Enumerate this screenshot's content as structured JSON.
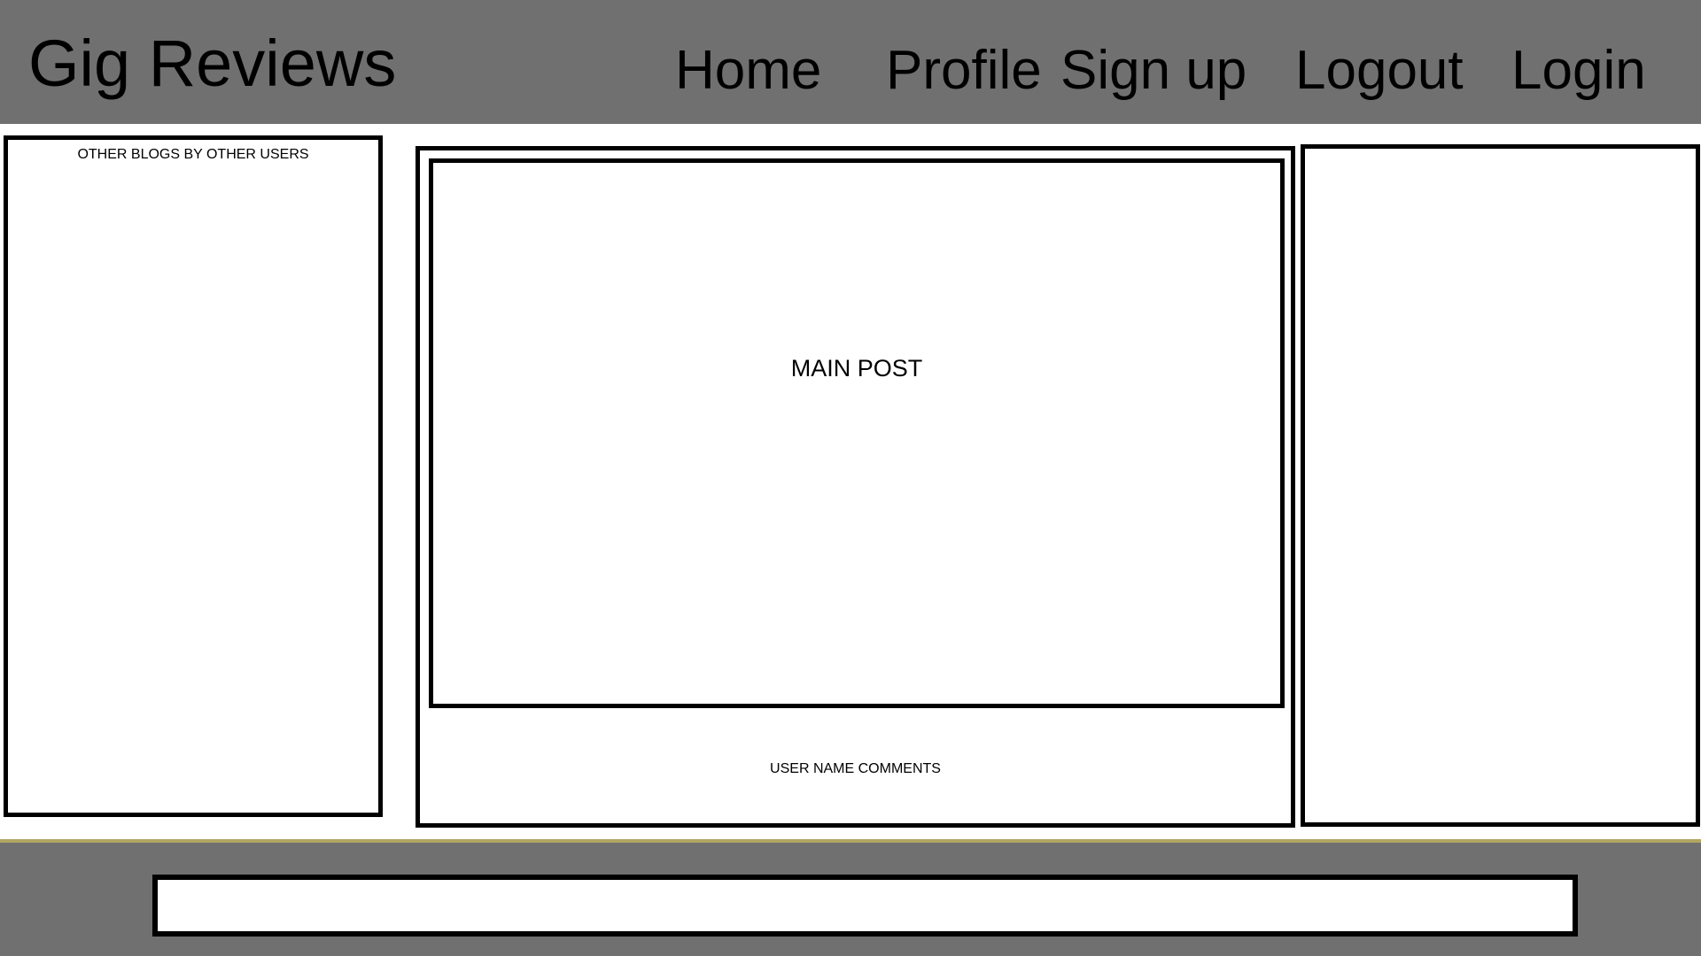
{
  "header": {
    "title": "Gig Reviews",
    "nav": {
      "home": "Home",
      "profile": "Profile",
      "signup": "Sign up",
      "logout": "Logout",
      "login": "Login"
    }
  },
  "sidebar_left": {
    "title": "OTHER BLOGS BY OTHER USERS"
  },
  "main": {
    "post_label": "MAIN POST",
    "comments_label": "USER NAME COMMENTS"
  },
  "colors": {
    "header_bg": "#707070",
    "footer_bg": "#707070",
    "footer_accent": "#b0a662",
    "border": "#000000",
    "panel_bg": "#ffffff"
  }
}
